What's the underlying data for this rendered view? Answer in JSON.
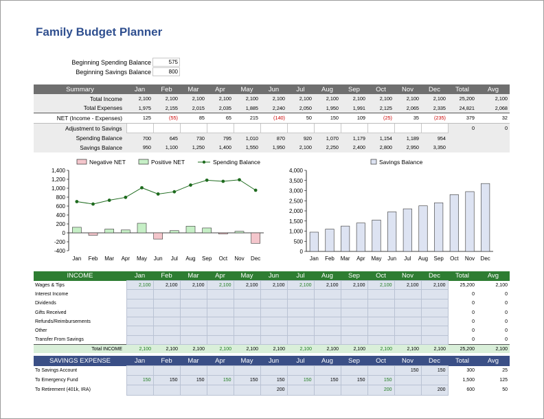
{
  "title": "Family Budget Planner",
  "balances": {
    "spending_label": "Beginning Spending Balance",
    "spending_value": "575",
    "savings_label": "Beginning Savings Balance",
    "savings_value": "800"
  },
  "months": [
    "Jan",
    "Feb",
    "Mar",
    "Apr",
    "May",
    "Jun",
    "Jul",
    "Aug",
    "Sep",
    "Oct",
    "Nov",
    "Dec"
  ],
  "summary": {
    "header": "Summary",
    "total_label": "Total",
    "avg_label": "Avg",
    "rows": [
      {
        "label": "Total Income",
        "values": [
          "2,100",
          "2,100",
          "2,100",
          "2,100",
          "2,100",
          "2,100",
          "2,100",
          "2,100",
          "2,100",
          "2,100",
          "2,100",
          "2,100"
        ],
        "total": "25,200",
        "avg": "2,100"
      },
      {
        "label": "Total Expenses",
        "values": [
          "1,975",
          "2,155",
          "2,015",
          "2,035",
          "1,885",
          "2,240",
          "2,050",
          "1,950",
          "1,991",
          "2,125",
          "2,065",
          "2,335"
        ],
        "total": "24,821",
        "avg": "2,068"
      },
      {
        "label": "NET (Income - Expenses)",
        "values": [
          "125",
          "(55)",
          "85",
          "65",
          "215",
          "(140)",
          "50",
          "150",
          "109",
          "(25)",
          "35",
          "(235)"
        ],
        "total": "379",
        "avg": "32"
      },
      {
        "label": "Adjustment to Savings",
        "values": [
          "",
          "",
          "",
          "",
          "",
          "",
          "",
          "",
          "",
          "",
          "",
          ""
        ],
        "total": "0",
        "avg": "0"
      },
      {
        "label": "Spending Balance",
        "values": [
          "700",
          "645",
          "730",
          "795",
          "1,010",
          "870",
          "920",
          "1,070",
          "1,179",
          "1,154",
          "1,189",
          "954"
        ],
        "total": "",
        "avg": ""
      },
      {
        "label": "Savings Balance",
        "values": [
          "950",
          "1,100",
          "1,250",
          "1,400",
          "1,550",
          "1,950",
          "2,100",
          "2,250",
          "2,400",
          "2,800",
          "2,950",
          "3,350"
        ],
        "total": "",
        "avg": ""
      }
    ]
  },
  "legend": {
    "negative": "Negative NET",
    "positive": "Positive NET",
    "spending": "Spending Balance",
    "savings": "Savings Balance"
  },
  "colors": {
    "negative_fill": "#f4c6cc",
    "positive_fill": "#c6efc6",
    "line": "#1e6b1e",
    "savings_fill": "#dde3f2",
    "income_header": "#2e7d32",
    "savings_header": "#3a4f86"
  },
  "chart_data": [
    {
      "type": "bar",
      "categories": [
        "Jan",
        "Feb",
        "Mar",
        "Apr",
        "May",
        "Jun",
        "Jul",
        "Aug",
        "Sep",
        "Oct",
        "Nov",
        "Dec"
      ],
      "series": [
        {
          "name": "Negative NET",
          "values": [
            0,
            -55,
            0,
            0,
            0,
            -140,
            0,
            0,
            0,
            -25,
            0,
            -235
          ]
        },
        {
          "name": "Positive NET",
          "values": [
            125,
            0,
            85,
            65,
            215,
            0,
            50,
            150,
            109,
            0,
            35,
            0
          ]
        },
        {
          "name": "Spending Balance",
          "type": "line",
          "values": [
            700,
            645,
            730,
            795,
            1010,
            870,
            920,
            1070,
            1179,
            1154,
            1189,
            954
          ]
        }
      ],
      "yticks": [
        "1,400",
        "1,200",
        "1,000",
        "800",
        "600",
        "400",
        "200",
        "0",
        "-200",
        "-400"
      ],
      "ylim": [
        -400,
        1400
      ],
      "legend": "top"
    },
    {
      "type": "bar",
      "categories": [
        "Jan",
        "Feb",
        "Mar",
        "Apr",
        "May",
        "Jun",
        "Jul",
        "Aug",
        "Sep",
        "Oct",
        "Nov",
        "Dec"
      ],
      "series": [
        {
          "name": "Savings Balance",
          "values": [
            950,
            1100,
            1250,
            1400,
            1550,
            1950,
            2100,
            2250,
            2400,
            2800,
            2950,
            3350
          ]
        }
      ],
      "yticks": [
        "4,000",
        "3,500",
        "3,000",
        "2,500",
        "2,000",
        "1,500",
        "1,000",
        "500",
        "0"
      ],
      "ylim": [
        0,
        4000
      ],
      "legend": "top"
    }
  ],
  "income": {
    "header": "INCOME",
    "rows": [
      {
        "label": "Wages & Tips",
        "values": [
          "2,100",
          "2,100",
          "2,100",
          "2,100",
          "2,100",
          "2,100",
          "2,100",
          "2,100",
          "2,100",
          "2,100",
          "2,100",
          "2,100"
        ],
        "total": "25,200",
        "avg": "2,100"
      },
      {
        "label": "Interest Income",
        "values": [
          "",
          "",
          "",
          "",
          "",
          "",
          "",
          "",
          "",
          "",
          "",
          ""
        ],
        "total": "0",
        "avg": "0"
      },
      {
        "label": "Dividends",
        "values": [
          "",
          "",
          "",
          "",
          "",
          "",
          "",
          "",
          "",
          "",
          "",
          ""
        ],
        "total": "0",
        "avg": "0"
      },
      {
        "label": "Gifts Received",
        "values": [
          "",
          "",
          "",
          "",
          "",
          "",
          "",
          "",
          "",
          "",
          "",
          ""
        ],
        "total": "0",
        "avg": "0"
      },
      {
        "label": "Refunds/Reimbursements",
        "values": [
          "",
          "",
          "",
          "",
          "",
          "",
          "",
          "",
          "",
          "",
          "",
          ""
        ],
        "total": "0",
        "avg": "0"
      },
      {
        "label": "Other",
        "values": [
          "",
          "",
          "",
          "",
          "",
          "",
          "",
          "",
          "",
          "",
          "",
          ""
        ],
        "total": "0",
        "avg": "0"
      },
      {
        "label": "Transfer From Savings",
        "values": [
          "",
          "",
          "",
          "",
          "",
          "",
          "",
          "",
          "",
          "",
          "",
          ""
        ],
        "total": "0",
        "avg": "0"
      }
    ],
    "total_row": {
      "label": "Total INCOME",
      "values": [
        "2,100",
        "2,100",
        "2,100",
        "2,100",
        "2,100",
        "2,100",
        "2,100",
        "2,100",
        "2,100",
        "2,100",
        "2,100",
        "2,100"
      ],
      "total": "25,200",
      "avg": "2,100"
    }
  },
  "savings": {
    "header": "SAVINGS EXPENSE",
    "rows": [
      {
        "label": "To Savings Account",
        "values": [
          "",
          "",
          "",
          "",
          "",
          "",
          "",
          "",
          "",
          "",
          "150",
          "150"
        ],
        "total": "300",
        "avg": "25"
      },
      {
        "label": "To Emergency Fund",
        "values": [
          "150",
          "150",
          "150",
          "150",
          "150",
          "150",
          "150",
          "150",
          "150",
          "150",
          "",
          ""
        ],
        "total": "1,500",
        "avg": "125"
      },
      {
        "label": "To Retirement (401k, IRA)",
        "values": [
          "",
          "",
          "",
          "",
          "",
          "200",
          "",
          "",
          "",
          "200",
          "",
          "200"
        ],
        "total": "600",
        "avg": "50"
      }
    ]
  }
}
